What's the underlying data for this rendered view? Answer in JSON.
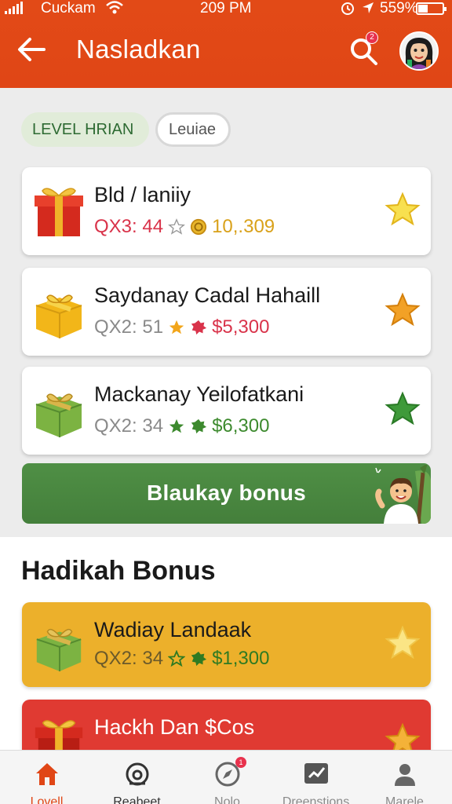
{
  "status_bar": {
    "carrier": "Cuckam",
    "time": "209 PM",
    "battery": "559%"
  },
  "header": {
    "title": "Nasladkan",
    "search_badge": "2",
    "icons": [
      "back-arrow-icon",
      "search-icon",
      "avatar"
    ]
  },
  "filters": {
    "active": "LEVEL HRIAN",
    "other": "Leuiae"
  },
  "cards": [
    {
      "name": "Bld / laniiy",
      "code": "QX3: 44",
      "price": "10,.309",
      "color": "#d9334a",
      "price_color": "#d9a11a",
      "gift": "red",
      "star": "yellow"
    },
    {
      "name": "Saydanay Cadal Hahaill",
      "code": "QX2: 51",
      "price": "$5,300",
      "color": "#8a8a8a",
      "price_color": "#d9334a",
      "gift": "yellow",
      "star": "orange"
    },
    {
      "name": "Mackanay Yeilofatkani",
      "code": "QX2: 34",
      "price": "$6,300",
      "color": "#8a8a8a",
      "price_color": "#3d8a2e",
      "gift": "green",
      "star": "green"
    }
  ],
  "cta": {
    "label": "Blaukay bonus"
  },
  "section": {
    "title": "Hadikah Bonus"
  },
  "bonus_cards": [
    {
      "name": "Wadiay Landaak",
      "code": "QX2: 34",
      "price": "$1,300",
      "bg": "#ecb02b",
      "gift": "green",
      "star": "light-yellow"
    },
    {
      "name": "Hackh Dan $Cos",
      "code": "",
      "price": "",
      "bg": "#e03a32",
      "gift": "red",
      "star": "yellow"
    }
  ],
  "nav": [
    {
      "label": "Lovell",
      "icon": "home-icon",
      "active": true
    },
    {
      "label": "Reabeet",
      "icon": "camera-icon",
      "active": false
    },
    {
      "label": "Nolo",
      "icon": "compass-icon",
      "active": false,
      "badge": "1"
    },
    {
      "label": "Dreenstions",
      "icon": "chart-icon",
      "active": false
    },
    {
      "label": "Marele",
      "icon": "profile-icon",
      "active": false
    }
  ],
  "colors": {
    "brand": "#e04616",
    "cta_green": "#4a8a40"
  }
}
